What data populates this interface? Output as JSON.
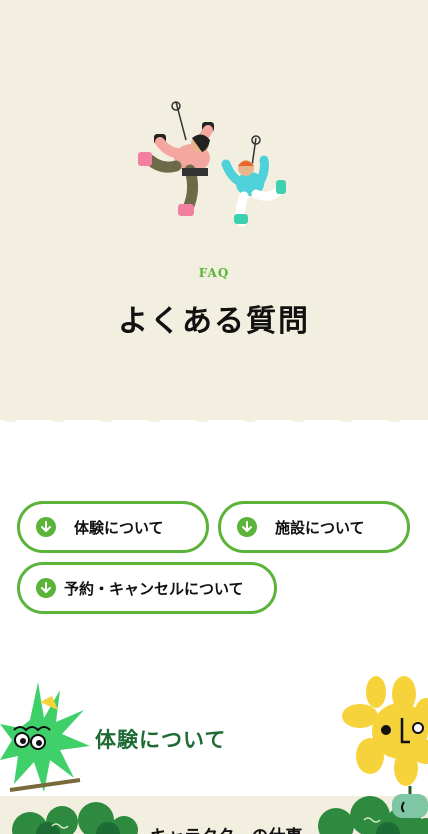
{
  "hero": {
    "eyebrow": "FAQ",
    "title": "よくある質問"
  },
  "nav": {
    "buttons": [
      {
        "label": "体験について",
        "icon": "arrow-down-circle-icon"
      },
      {
        "label": "施設について",
        "icon": "arrow-down-circle-icon"
      },
      {
        "label": "予約・キャンセルについて",
        "icon": "arrow-down-circle-icon"
      }
    ]
  },
  "section": {
    "title": "体験について",
    "subheading": "キャラクターの仕事"
  },
  "colors": {
    "hero_bg": "#f3efe0",
    "accent_green": "#5bb33a",
    "section_green": "#1f6b35"
  }
}
